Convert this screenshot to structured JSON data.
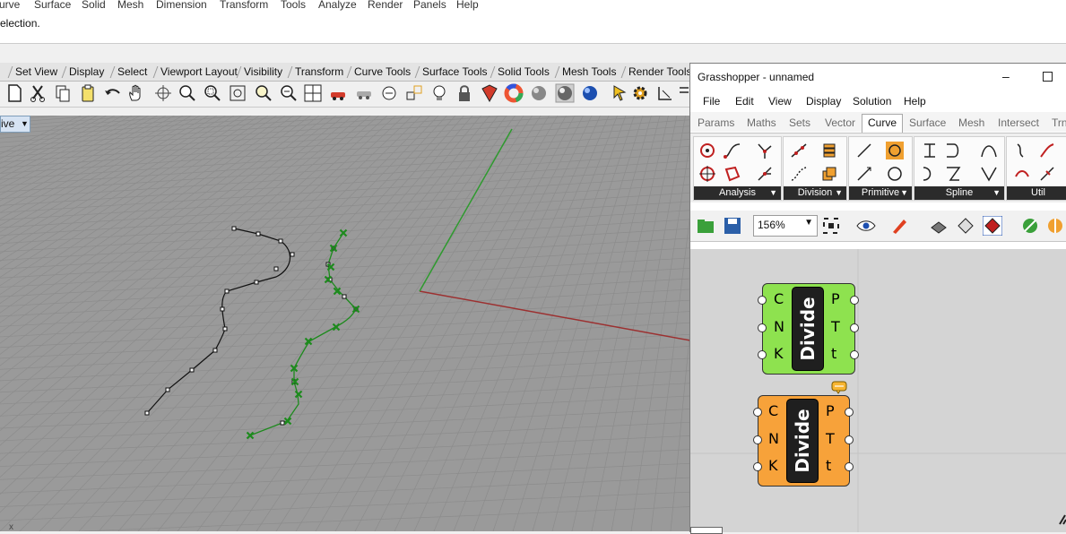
{
  "rhino": {
    "menu": [
      "urve",
      "Surface",
      "Solid",
      "Mesh",
      "Dimension",
      "Transform",
      "Tools",
      "Analyze",
      "Render",
      "Panels",
      "Help"
    ],
    "command_text": "election.",
    "toolbar_tabs": [
      "Set View",
      "Display",
      "Select",
      "Viewport Layout",
      "Visibility",
      "Transform",
      "Curve Tools",
      "Surface Tools",
      "Solid Tools",
      "Mesh Tools",
      "Render Tools"
    ],
    "viewport_tab": "ive",
    "axis_label": "x",
    "colors": {
      "viewport_bg": "#9a9a9a",
      "grid": "#8c8c8c",
      "x_axis": "#9c3030",
      "y_axis": "#2e9a2e",
      "curve_black": "#111111",
      "curve_green": "#1d8a1d"
    }
  },
  "grasshopper": {
    "title": "Grasshopper - unnamed",
    "minimize": "–",
    "menu": [
      "File",
      "Edit",
      "View",
      "Display",
      "Solution",
      "Help"
    ],
    "component_tabs": [
      "Params",
      "Maths",
      "Sets",
      "Vector",
      "Curve",
      "Surface",
      "Mesh",
      "Intersect",
      "Trn"
    ],
    "active_tab": "Curve",
    "panels": [
      "Analysis",
      "Division",
      "Primitive",
      "Spline",
      "Util"
    ],
    "zoom": "156%",
    "components": [
      {
        "name": "Divide",
        "inputs": [
          "C",
          "N",
          "K"
        ],
        "outputs": [
          "P",
          "T",
          "t"
        ],
        "color": "#8ee24f",
        "state": "ok"
      },
      {
        "name": "Divide",
        "inputs": [
          "C",
          "N",
          "K"
        ],
        "outputs": [
          "P",
          "T",
          "t"
        ],
        "color": "#f7a23a",
        "state": "warning"
      }
    ]
  }
}
